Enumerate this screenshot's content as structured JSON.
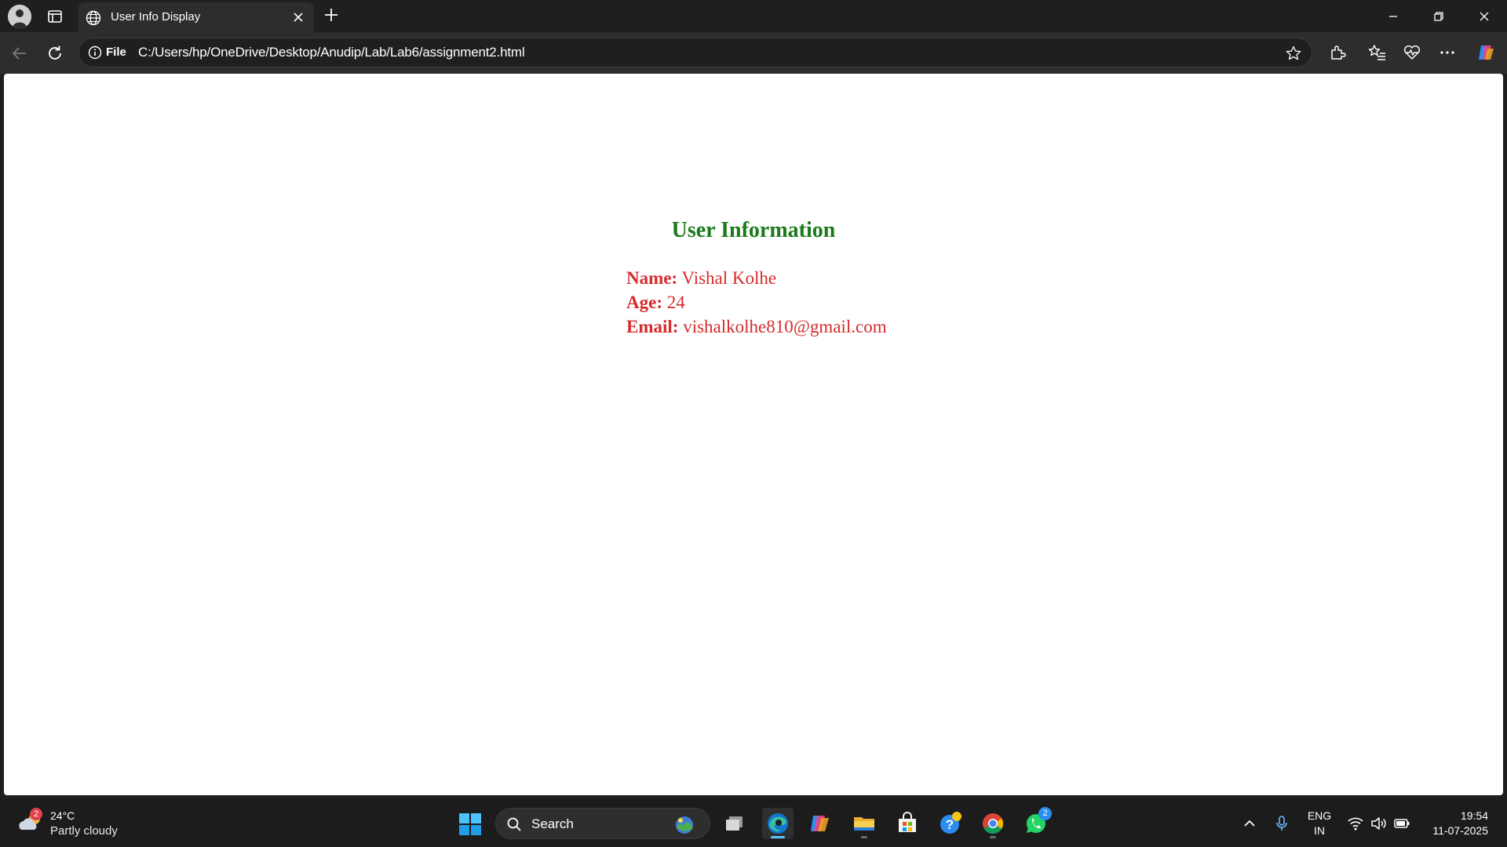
{
  "browser": {
    "tab_title": "User Info Display",
    "url_scheme_label": "File",
    "url": "C:/Users/hp/OneDrive/Desktop/Anudip/Lab/Lab6/assignment2.html"
  },
  "page": {
    "heading": "User Information",
    "fields": {
      "name_label": "Name:",
      "name_value": "Vishal Kolhe",
      "age_label": "Age:",
      "age_value": "24",
      "email_label": "Email:",
      "email_value": "vishalkolhe810@gmail.com"
    },
    "colors": {
      "heading": "#1a7a1a",
      "text": "#d62b2b"
    }
  },
  "taskbar": {
    "weather": {
      "badge": "2",
      "temp": "24°C",
      "desc": "Partly cloudy"
    },
    "search_label": "Search",
    "apps": [
      {
        "icon": "task-view-icon"
      },
      {
        "icon": "edge-icon"
      },
      {
        "icon": "copilot-icon"
      },
      {
        "icon": "file-explorer-icon"
      },
      {
        "icon": "microsoft-store-icon"
      },
      {
        "icon": "get-help-icon"
      },
      {
        "icon": "chrome-icon"
      },
      {
        "icon": "whatsapp-icon",
        "badge": "2"
      }
    ],
    "lang_line1": "ENG",
    "lang_line2": "IN",
    "time": "19:54",
    "date": "11-07-2025"
  }
}
